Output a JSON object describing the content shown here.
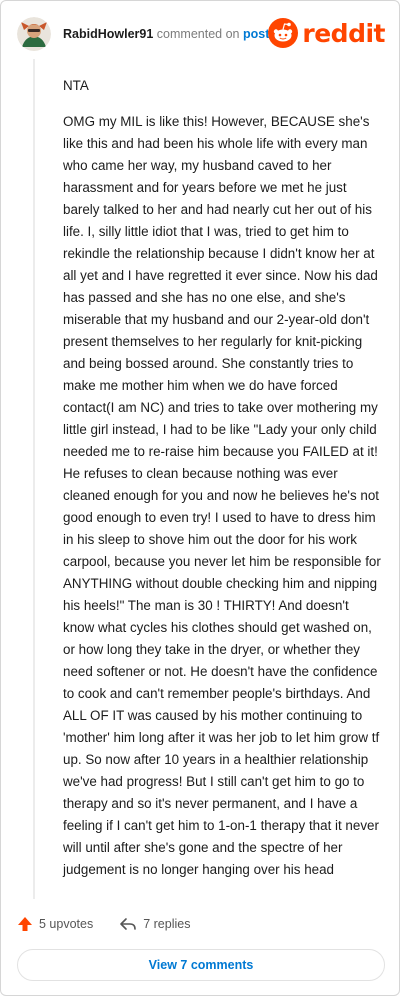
{
  "header": {
    "username": "RabidHowler91",
    "commented_on_text": "commented on",
    "post_link": "post",
    "brand": "reddit"
  },
  "comment": {
    "paragraphs": [
      "NTA",
      "OMG my MIL is like this! However, BECAUSE she's like this and had been his whole life with every man who came her way, my husband caved to her harassment and for years before we met he just barely talked to her and had nearly cut her out of his life. I, silly little idiot that I was, tried to get him to rekindle the relationship because I didn't know her at all yet and I have regretted it ever since. Now his dad has passed and she has no one else, and she's miserable that my husband and our 2-year-old don't present themselves to her regularly for knit-picking and being bossed around. She constantly tries to make me mother him when we do have forced contact(I am NC) and tries to take over mothering my little girl instead, I had to be like \"Lady your only child needed me to re-raise him because you FAILED at it! He refuses to clean because nothing was ever cleaned enough for you and now he believes he's not good enough to even try! I used to have to dress him in his sleep to shove him out the door for his work carpool, because you never let him be responsible for ANYTHING without double checking him and nipping his heels!\" The man is 30 ! THIRTY! And doesn't know what cycles his clothes should get washed on, or how long they take in the dryer, or whether they need softener or not. He doesn't have the confidence to cook and can't remember people's birthdays. And ALL OF IT was caused by his mother continuing to 'mother' him long after it was her job to let him grow tf up. So now after 10 years in a healthier relationship we've had progress! But I still can't get him to go to therapy and so it's never permanent, and I have a feeling if I can't get him to 1-on-1 therapy that it never will until after she's gone and the spectre of her judgement is no longer hanging over his head"
    ]
  },
  "actions": {
    "upvotes": "5 upvotes",
    "replies": "7 replies"
  },
  "view_comments_label": "View 7 comments",
  "colors": {
    "brand_orange": "#ff4500",
    "link_blue": "#0079d3"
  },
  "icons": [
    "avatar",
    "reddit-logo-icon",
    "upvote-arrow-icon",
    "reply-arrow-icon"
  ]
}
